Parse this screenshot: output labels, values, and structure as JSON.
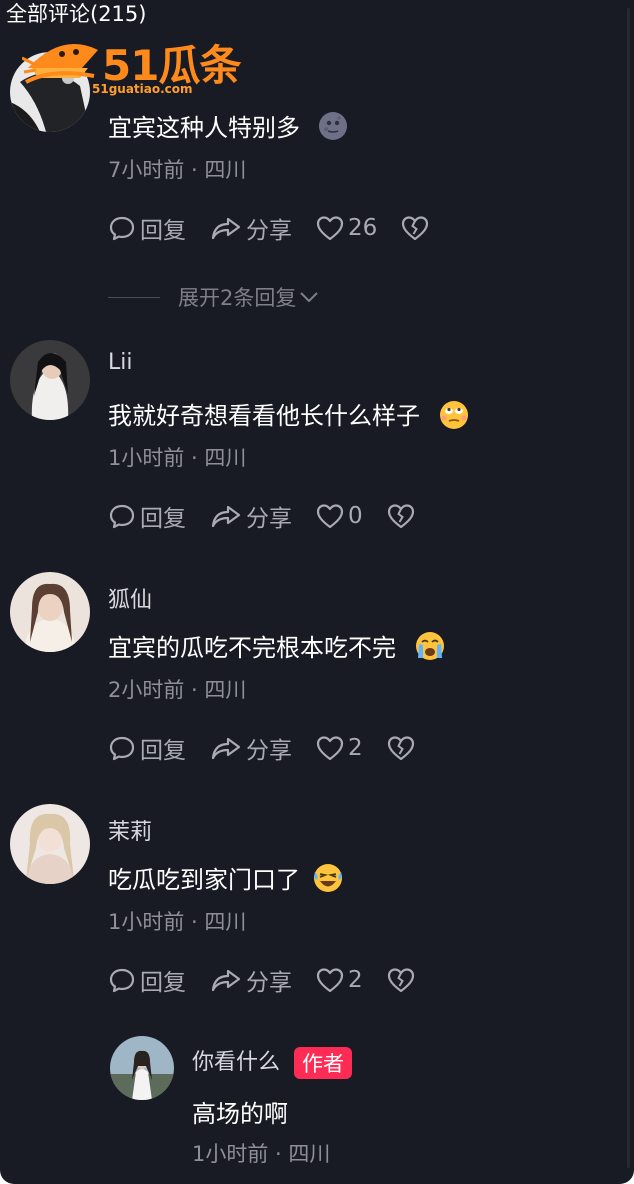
{
  "header": {
    "title": "全部评论(215)"
  },
  "watermark": {
    "brand": "51瓜条",
    "url": "51guatiao.com"
  },
  "comments": [
    {
      "name": "",
      "text": "宜宾这种人特别多",
      "meta": "7小时前 · 四川",
      "reply": "回复",
      "share": "分享",
      "likes": "26",
      "emoji": "new-moon-face",
      "expand": "展开2条回复"
    },
    {
      "name": "Lii",
      "text": "我就好奇想看看他长什么样子",
      "meta": "1小时前 · 四川",
      "reply": "回复",
      "share": "分享",
      "likes": "0",
      "emoji": "rolling-eyes-face"
    },
    {
      "name": "狐仙",
      "text": "宜宾的瓜吃不完根本吃不完",
      "meta": "2小时前 · 四川",
      "reply": "回复",
      "share": "分享",
      "likes": "2",
      "emoji": "crying-face"
    },
    {
      "name": "茉莉",
      "text": "吃瓜吃到家门口了",
      "meta": "1小时前 · 四川",
      "reply": "回复",
      "share": "分享",
      "likes": "2",
      "emoji": "laughing-tears-face"
    }
  ],
  "reply": {
    "name": "你看什么",
    "badge": "作者",
    "text": "高场的啊",
    "meta": "1小时前 · 四川"
  },
  "colors": {
    "background": "#181a24",
    "badge": "#fe2c55",
    "logo": "#ff8a1c"
  }
}
